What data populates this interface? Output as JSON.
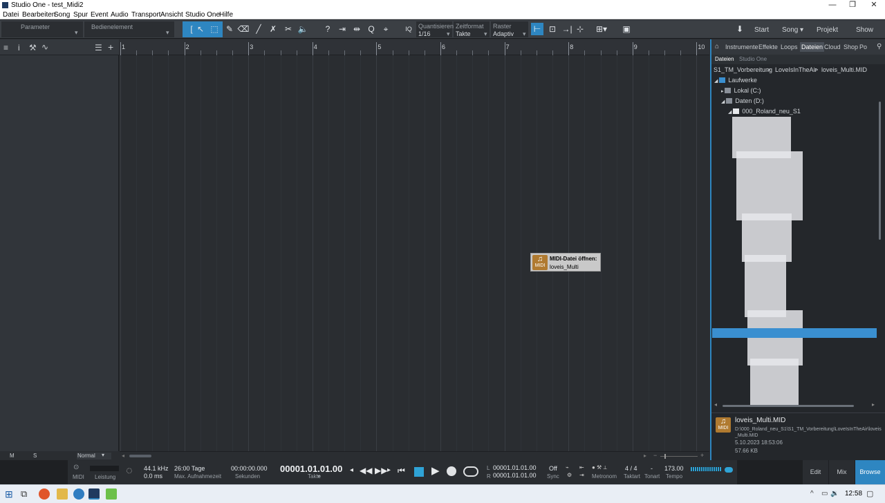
{
  "window": {
    "title": "Studio One - test_Midi2",
    "minimize": "—",
    "restore": "❐",
    "close": "✕"
  },
  "menu": [
    "Datei",
    "Bearbeiten",
    "Song",
    "Spur",
    "Event",
    "Audio",
    "Transport",
    "Ansicht",
    "Studio One",
    "Hilfe"
  ],
  "toolbar": {
    "parameter_label": "Parameter",
    "control_label": "Bedienelement",
    "quantize_label": "Quantisieren",
    "quantize_value": "1/16",
    "timeformat_label": "Zeitformat",
    "timeformat_value": "Takte",
    "grid_label": "Raster",
    "grid_value": "Adaptiv",
    "iq": "IQ",
    "nav": {
      "start": "Start",
      "song": "Song",
      "project": "Projekt",
      "show": "Show"
    }
  },
  "ruler": {
    "bars": [
      "1",
      "2",
      "3",
      "4",
      "5",
      "6",
      "7",
      "8",
      "9",
      "10"
    ]
  },
  "inspector_footer": {
    "mute": "M",
    "solo": "S",
    "mode": "Normal"
  },
  "tooltip": {
    "title": "MIDI-Datei öffnen:",
    "file": "loveis_Multi",
    "badge": "MIDI"
  },
  "browser": {
    "tabs": [
      "Instrumente",
      "Effekte",
      "Loops",
      "Dateien",
      "Cloud",
      "Shop",
      "Po"
    ],
    "active_tab": "Dateien",
    "subtabs": [
      "Dateien",
      "Studio One"
    ],
    "breadcrumb": [
      "S1_TM_Vorbereitung",
      ">",
      "LoveIsInTheAir",
      ">",
      "loveis_Multi.MID"
    ],
    "tree": {
      "root": "Laufwerke",
      "drive_c": "Lokal (C:)",
      "drive_d": "Daten (D:)",
      "folder": "000_Roland_neu_S1"
    },
    "file": {
      "name": "loveis_Multi.MID",
      "path": "D:\\000_Roland_neu_S1\\S1_TM_Vorbereitung\\LoveIsInTheAir\\loveis_Multi.MID",
      "date": "5.10.2023 18:53:06",
      "size": "57.66 KB",
      "badge": "MIDI"
    }
  },
  "transport": {
    "midi_label": "MIDI",
    "perf_label": "Leistung",
    "samplerate": "44.1 kHz",
    "latency": "0.0 ms",
    "rec_time": "26:00 Tage",
    "rec_label": "Max. Aufnahmezeit",
    "seconds": "00:00:00.000",
    "seconds_label": "Sekunden",
    "position": "00001.01.01.00",
    "position_label": "Takte",
    "loop_l": "00001.01.01.00",
    "loop_r": "00001.01.01.00",
    "l_label": "L",
    "r_label": "R",
    "sync_value": "Off",
    "sync_label": "Sync",
    "metronome_label": "Metronom",
    "timesig": "4 / 4",
    "timesig_label": "Taktart",
    "key": "-",
    "key_label": "Tonart",
    "tempo": "173.00",
    "tempo_label": "Tempo"
  },
  "page_buttons": [
    "Edit",
    "Mix",
    "Browse"
  ],
  "taskbar": {
    "time": "12:58",
    "lang": "ENG"
  }
}
